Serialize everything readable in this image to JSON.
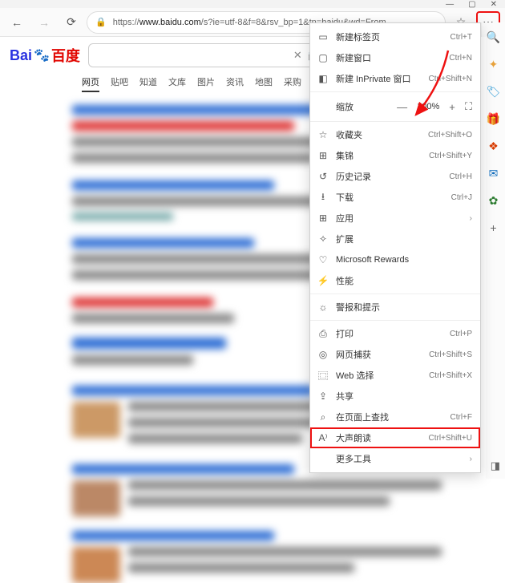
{
  "titlebar": {
    "min": "—",
    "max": "▢",
    "close": "✕"
  },
  "toolbar": {
    "back_icon": "←",
    "forward_icon": "→",
    "refresh_icon": "⟳",
    "lock_icon": "🔒",
    "url_host": "www.baidu.com",
    "url_rest": "/s?ie=utf-8&f=8&rsv_bp=1&tn=baidu&wd=From",
    "star_icon": "☆",
    "more_icon": "⋯"
  },
  "sidebar": {
    "items": [
      {
        "name": "search-icon",
        "glyph": "🔍",
        "color": "#0a84ff"
      },
      {
        "name": "sparkle-icon",
        "glyph": "✦",
        "color": "#e8a33d"
      },
      {
        "name": "tag-icon",
        "glyph": "🏷",
        "color": "#2e9bd6"
      },
      {
        "name": "gift-icon",
        "glyph": "🎁",
        "color": "#2fa866"
      },
      {
        "name": "office-icon",
        "glyph": "❖",
        "color": "#d83b01"
      },
      {
        "name": "outlook-icon",
        "glyph": "✉",
        "color": "#0f6cbd"
      },
      {
        "name": "leaf-icon",
        "glyph": "✿",
        "color": "#2e7d32"
      },
      {
        "name": "plus-icon",
        "glyph": "+",
        "color": "#666"
      }
    ]
  },
  "baidu": {
    "logo_bai": "Bai",
    "logo_du": "百度",
    "paw": "🐾",
    "clear_icon": "✕",
    "camera_icon": "📷",
    "tabs": [
      "网页",
      "贴吧",
      "知道",
      "文库",
      "图片",
      "资讯",
      "地图",
      "采购"
    ]
  },
  "menu": {
    "items": [
      {
        "icon": "▭",
        "label": "新建标签页",
        "shortcut": "Ctrl+T",
        "sep": false
      },
      {
        "icon": "▢",
        "label": "新建窗口",
        "shortcut": "Ctrl+N",
        "sep": false
      },
      {
        "icon": "◧",
        "label": "新建 InPrivate 窗口",
        "shortcut": "Ctrl+Shift+N",
        "sep": true
      },
      {
        "zoom": true,
        "label": "缩放",
        "minus": "—",
        "value": "100%",
        "plus": "+",
        "full": "⛶",
        "sep": true
      },
      {
        "icon": "☆",
        "label": "收藏夹",
        "shortcut": "Ctrl+Shift+O",
        "sep": false
      },
      {
        "icon": "⊞",
        "label": "集锦",
        "shortcut": "Ctrl+Shift+Y",
        "sep": false
      },
      {
        "icon": "↺",
        "label": "历史记录",
        "shortcut": "Ctrl+H",
        "sep": false
      },
      {
        "icon": "⭳",
        "label": "下载",
        "shortcut": "Ctrl+J",
        "sep": false
      },
      {
        "icon": "⊞",
        "label": "应用",
        "shortcut": "",
        "chev": true,
        "sep": false
      },
      {
        "icon": "�ои",
        "label": "扩展",
        "shortcut": "",
        "sep": false,
        "iconAlt": "✧"
      },
      {
        "icon": "♡",
        "label": "Microsoft Rewards",
        "shortcut": "",
        "sep": false
      },
      {
        "icon": "⚡",
        "label": "性能",
        "shortcut": "",
        "sep": true
      },
      {
        "icon": "☼",
        "label": "警报和提示",
        "shortcut": "",
        "sep": true
      },
      {
        "icon": "⎙",
        "label": "打印",
        "shortcut": "Ctrl+P",
        "sep": false
      },
      {
        "icon": "◎",
        "label": "网页捕获",
        "shortcut": "Ctrl+Shift+S",
        "sep": false
      },
      {
        "icon": "⿴",
        "label": "Web 选择",
        "shortcut": "Ctrl+Shift+X",
        "sep": false
      },
      {
        "icon": "⇪",
        "label": "共享",
        "shortcut": "",
        "sep": false
      },
      {
        "icon": "⌕",
        "label": "在页面上查找",
        "shortcut": "Ctrl+F",
        "sep": false
      },
      {
        "icon": "A⁾",
        "label": "大声朗读",
        "shortcut": "Ctrl+Shift+U",
        "highlight": true,
        "sep": false
      },
      {
        "icon": "",
        "label": "更多工具",
        "shortcut": "",
        "chev": true,
        "sep": false
      }
    ]
  }
}
